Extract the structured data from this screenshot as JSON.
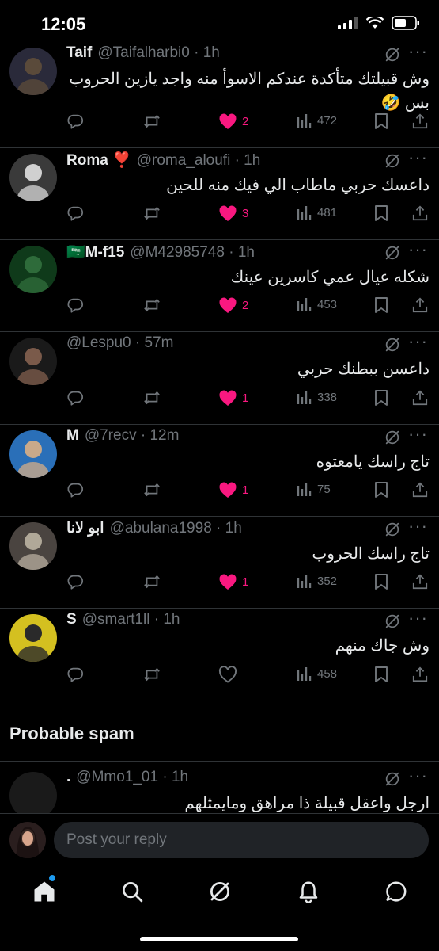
{
  "status_bar": {
    "time": "12:05"
  },
  "replies": [
    {
      "name": "Taif",
      "handle": "@Taifalharbi0 · 1h",
      "text": "وش قبيلتك متأكدة عندكم الاسوأ منه واجد يازين الحروب بس 🤣",
      "likes": "2",
      "liked": true,
      "views": "472",
      "avatar_colors": [
        "#5a4a3a",
        "#2a2a3a"
      ]
    },
    {
      "name": "Roma ❣️",
      "handle": "@roma_aloufi · 1h",
      "text": "داعسك حربي ماطاب الي فيك منه للحين",
      "likes": "3",
      "liked": true,
      "views": "481",
      "avatar_colors": [
        "#d0d0d0",
        "#3a3a3a"
      ]
    },
    {
      "name": "🇸🇦M-f15",
      "handle": "@M42985748 · 1h",
      "text": "شكله عيال عمي كاسرين عينك",
      "likes": "2",
      "liked": true,
      "views": "453",
      "avatar_colors": [
        "#2e6b3a",
        "#0f3a1a"
      ]
    },
    {
      "name": "",
      "handle": "@Lespu0 · 57m",
      "text": "داعسن ببطنك حربي",
      "likes": "1",
      "liked": true,
      "views": "338",
      "avatar_colors": [
        "#7a5a4a",
        "#1a1a1a"
      ]
    },
    {
      "name": "M",
      "handle": "@7recv · 12m",
      "text": "تاج راسك يامعتوه",
      "likes": "1",
      "liked": true,
      "views": "75",
      "avatar_colors": [
        "#c9a98a",
        "#2a6fb8"
      ]
    },
    {
      "name": "ابو لانا",
      "handle": "@abulana1998 · 1h",
      "text": "تاج راسك الحروب",
      "likes": "1",
      "liked": true,
      "views": "352",
      "avatar_colors": [
        "#b0a898",
        "#4a4440"
      ]
    },
    {
      "name": "S",
      "handle": "@smart1ll · 1h",
      "text": "وش جاك منهم",
      "likes": "",
      "liked": false,
      "views": "458",
      "avatar_colors": [
        "#2a2a2a",
        "#d4c020"
      ]
    }
  ],
  "section": {
    "title": "Probable spam"
  },
  "spam_reply": {
    "name": ".",
    "handle": "@Mmo1_01 · 1h",
    "text": "ارجل واعقل قبيلة ذا مراهق ومايمثلهم"
  },
  "compose": {
    "placeholder": "Post your reply"
  },
  "colors": {
    "accent": "#1d9bf0",
    "like": "#f91880",
    "muted": "#71767b",
    "text": "#e7e9ea"
  },
  "icons": [
    "reply-icon",
    "repost-icon",
    "heart-icon",
    "views-icon",
    "bookmark-icon",
    "share-icon",
    "grok-icon",
    "more-icon",
    "home-icon",
    "search-icon",
    "notifications-icon",
    "messages-icon"
  ]
}
